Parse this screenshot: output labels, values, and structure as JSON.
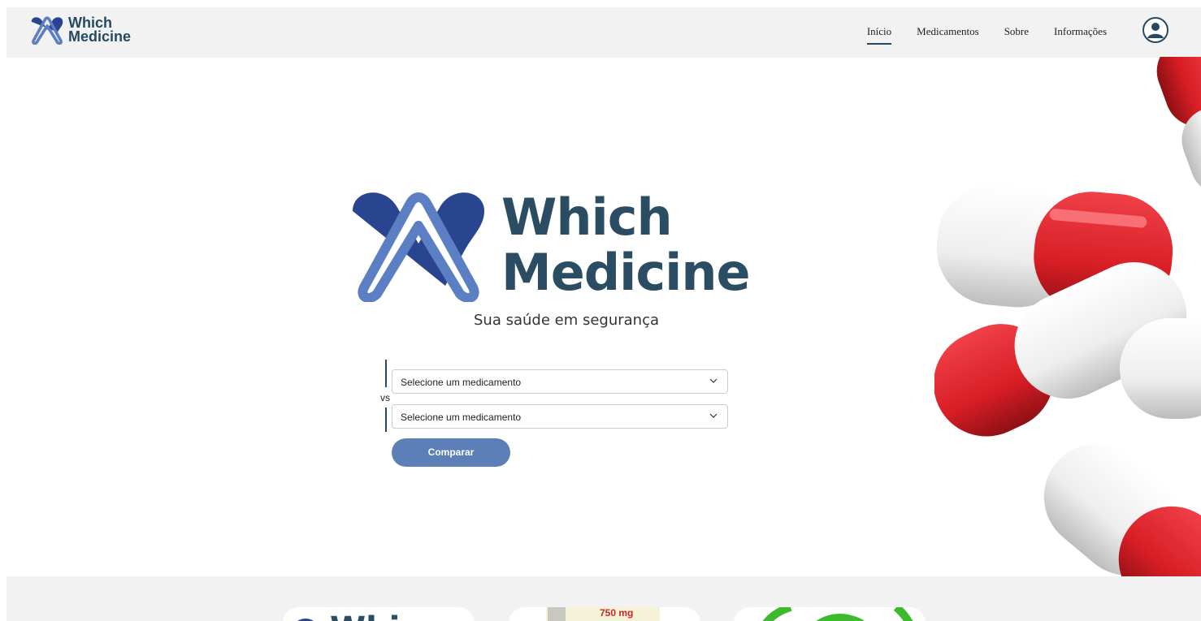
{
  "brand": {
    "line1": "Which",
    "line2": "Medicine"
  },
  "nav": [
    {
      "label": "Início",
      "active": true
    },
    {
      "label": "Medicamentos",
      "active": false
    },
    {
      "label": "Sobre",
      "active": false
    },
    {
      "label": "Informações",
      "active": false
    }
  ],
  "account": {
    "icon": "user-circle-icon"
  },
  "hero": {
    "title_line1": "Which",
    "title_line2": "Medicine",
    "tagline": "Sua saúde em segurança"
  },
  "compare": {
    "select1_value": "Selecione um medicamento",
    "select2_value": "Selecione um medicamento",
    "vs_label": "vs",
    "button_label": "Comparar"
  },
  "bottom_cards": {
    "card2_text": "750 mg"
  },
  "colors": {
    "brand_dark": "#244a63",
    "brand_blue": "#5c7fb8",
    "pill_red": "#d81e25"
  }
}
